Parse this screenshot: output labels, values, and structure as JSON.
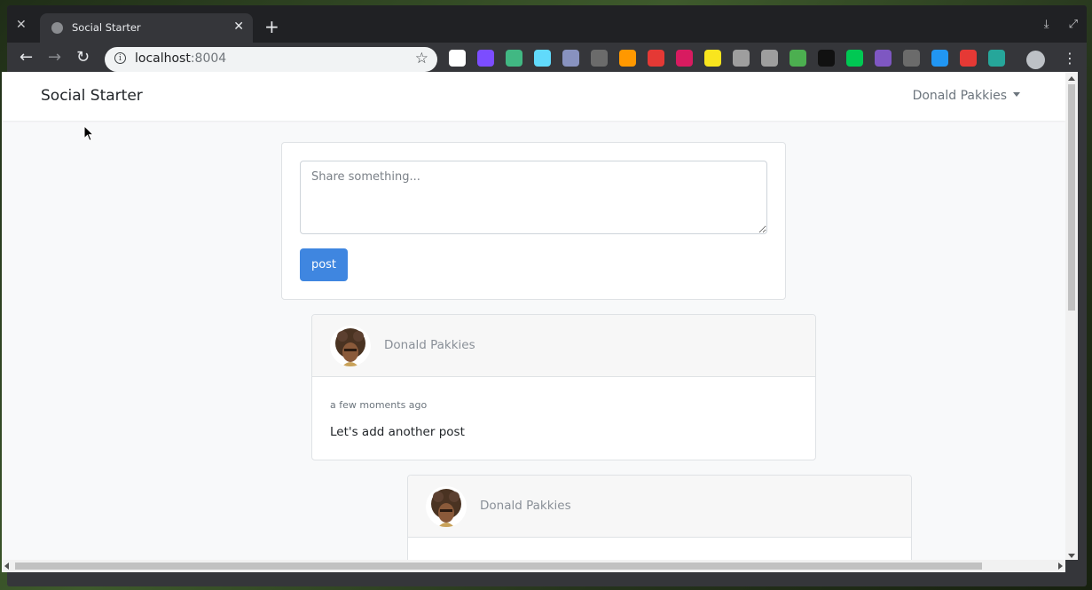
{
  "browser": {
    "tab_title": "Social Starter",
    "url_host": "localhost",
    "url_port": ":8004",
    "extension_colors": [
      "#ffffff",
      "#7c4dff",
      "#41b883",
      "#61dafb",
      "#8892bf",
      "#6b6b6b",
      "#ff9800",
      "#e53935",
      "#d81b60",
      "#f9e51e",
      "#9e9e9e",
      "#9e9e9e",
      "#4caf50",
      "#111111",
      "#00c853",
      "#7e57c2",
      "#6b6b6b",
      "#2196f3",
      "#e53935",
      "#26a69a"
    ]
  },
  "app": {
    "brand": "Social Starter",
    "user_menu": "Donald Pakkies",
    "composer": {
      "placeholder": "Share something...",
      "button_label": "post"
    },
    "posts": [
      {
        "author": "Donald Pakkies",
        "time": "a few moments ago",
        "body": "Let's add another post"
      },
      {
        "author": "Donald Pakkies",
        "time": "",
        "body": ""
      }
    ]
  },
  "colors": {
    "primary": "#3f86e0",
    "muted": "#6c757d"
  }
}
